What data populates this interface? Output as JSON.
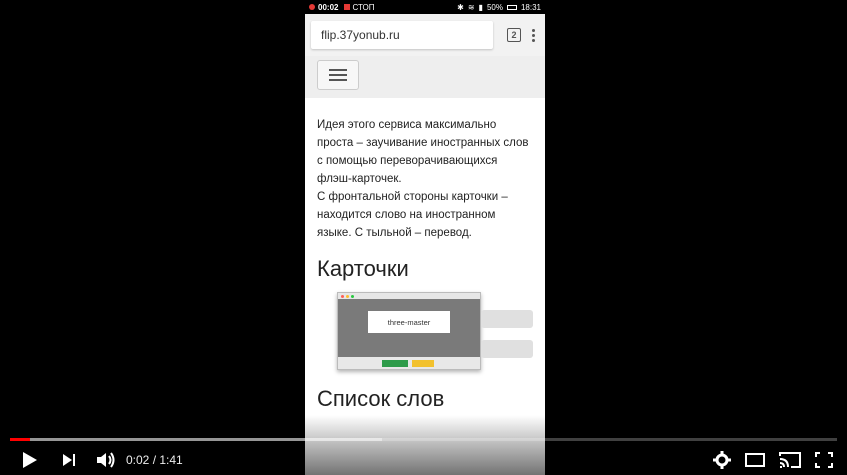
{
  "phone": {
    "status": {
      "rec_time": "00:02",
      "stop_label": "СТОП",
      "battery": "50%",
      "clock": "18:31"
    },
    "browser": {
      "url": "flip.37yonub.ru",
      "tab_count": "2"
    },
    "article": {
      "paragraph": "Идея этого сервиса максимально проста – заучивание иностранных слов с помощью переворачивающихся флэш-карточек.",
      "paragraph2": "С фронтальной стороны карточки – находится слово на иностранном языке. С тыльной – перевод.",
      "heading_cards": "Карточки",
      "card_word": "three-master",
      "heading_words": "Список слов"
    }
  },
  "player": {
    "time_current": "0:02",
    "time_separator": " / ",
    "time_total": "1:41",
    "progress_played": 0.024,
    "progress_buffered": 0.45,
    "accent_color": "#ff0000",
    "icons": [
      "play-icon",
      "next-icon",
      "volume-icon",
      "settings-icon",
      "theater-icon",
      "cast-icon",
      "fullscreen-icon"
    ]
  }
}
